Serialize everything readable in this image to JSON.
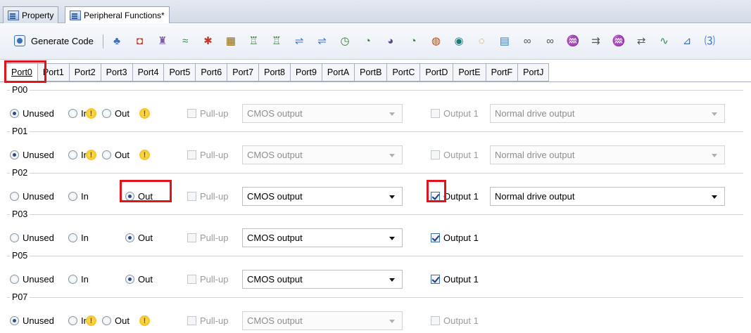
{
  "doc_tabs": [
    {
      "label": "Property",
      "active": false
    },
    {
      "label": "Peripheral Functions*",
      "active": true
    }
  ],
  "toolbar": {
    "generate_label": "Generate Code",
    "icons": [
      "pin-config-icon",
      "clock-icon",
      "interrupt-icon",
      "chart-icon",
      "reset-icon",
      "chip-icon",
      "timer-array-icon",
      "timer-array-2-icon",
      "serial-icon",
      "serial-2-icon",
      "watchdog-icon",
      "timer-icon",
      "rtc-icon",
      "interval-icon",
      "clock-output-icon",
      "buzzer-icon",
      "watch-icon",
      "display-icon",
      "link-icon",
      "link-2-icon",
      "dma-icon",
      "comparator-icon",
      "dma-2-icon",
      "data-transfer-icon",
      "waveform-icon",
      "voltage-detect-icon",
      "counter-icon"
    ]
  },
  "port_tabs": [
    "Port0",
    "Port1",
    "Port2",
    "Port3",
    "Port4",
    "Port5",
    "Port6",
    "Port7",
    "Port8",
    "Port9",
    "PortA",
    "PortB",
    "PortC",
    "PortD",
    "PortE",
    "PortF",
    "PortJ"
  ],
  "active_port": "Port0",
  "labels": {
    "unused": "Unused",
    "in": "In",
    "out": "Out",
    "pullup": "Pull-up",
    "output1": "Output 1",
    "warn": "!"
  },
  "pins": [
    {
      "name": "P00",
      "mode": "Unused",
      "warn": true,
      "pullup": false,
      "output_type": "CMOS output",
      "output1": false,
      "drive": "Normal drive output",
      "enabled": false
    },
    {
      "name": "P01",
      "mode": "Unused",
      "warn": true,
      "pullup": false,
      "output_type": "CMOS output",
      "output1": false,
      "drive": "Normal drive output",
      "enabled": false
    },
    {
      "name": "P02",
      "mode": "Out",
      "warn": false,
      "pullup": false,
      "output_type": "CMOS output",
      "output1": true,
      "drive": "Normal drive output",
      "enabled": true
    },
    {
      "name": "P03",
      "mode": "Out",
      "warn": false,
      "pullup": false,
      "output_type": "CMOS output",
      "output1": true,
      "drive": null,
      "enabled": true
    },
    {
      "name": "P05",
      "mode": "Out",
      "warn": false,
      "pullup": false,
      "output_type": "CMOS output",
      "output1": true,
      "drive": null,
      "enabled": true
    },
    {
      "name": "P07",
      "mode": "Unused",
      "warn": true,
      "pullup": false,
      "output_type": "CMOS output",
      "output1": false,
      "drive": null,
      "enabled": false
    }
  ],
  "highlight_color": "#e0151c"
}
